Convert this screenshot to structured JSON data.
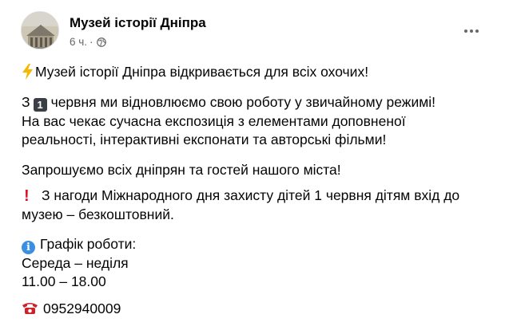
{
  "post": {
    "page_name": "Музей історії Дніпра",
    "time": "6 ч.",
    "dot": "·",
    "lines": {
      "l1": "Музей історії Дніпра відкривається для всіх охочих!",
      "l2a": "З",
      "l2num": "1",
      "l2b": "червня ми відновлюємо свою роботу у звичайному режимі!",
      "l3": "На вас чекає сучасна експозиція з елементами доповненої",
      "l4": "реальності, інтерактивні експонати та авторські фільми!",
      "l5": "Запрошуємо всіх дніпрян та гостей нашого міста!",
      "l6": "З нагоди Міжнародного дня захисту дітей 1 червня дітям вхід до",
      "l7": "музею – безкоштовний.",
      "l8": "Графік роботи:",
      "l9": "Середа – неділя",
      "l10": "11.00 – 18.00",
      "l11": "0952940009"
    }
  },
  "icons": {
    "avatar": "museum-building-photo",
    "globe": "globe-icon",
    "more": "more-options-icon",
    "lightning": "lightning-icon",
    "number_one": "keycap-one-icon",
    "exclamation": "exclamation-icon",
    "info": "info-icon",
    "phone": "telephone-icon"
  },
  "colors": {
    "text": "#050505",
    "secondary": "#65676b",
    "lightning": "#f5b800",
    "exclamation": "#e0102a",
    "info": "#3b8fe0",
    "phone": "#d0202a"
  }
}
